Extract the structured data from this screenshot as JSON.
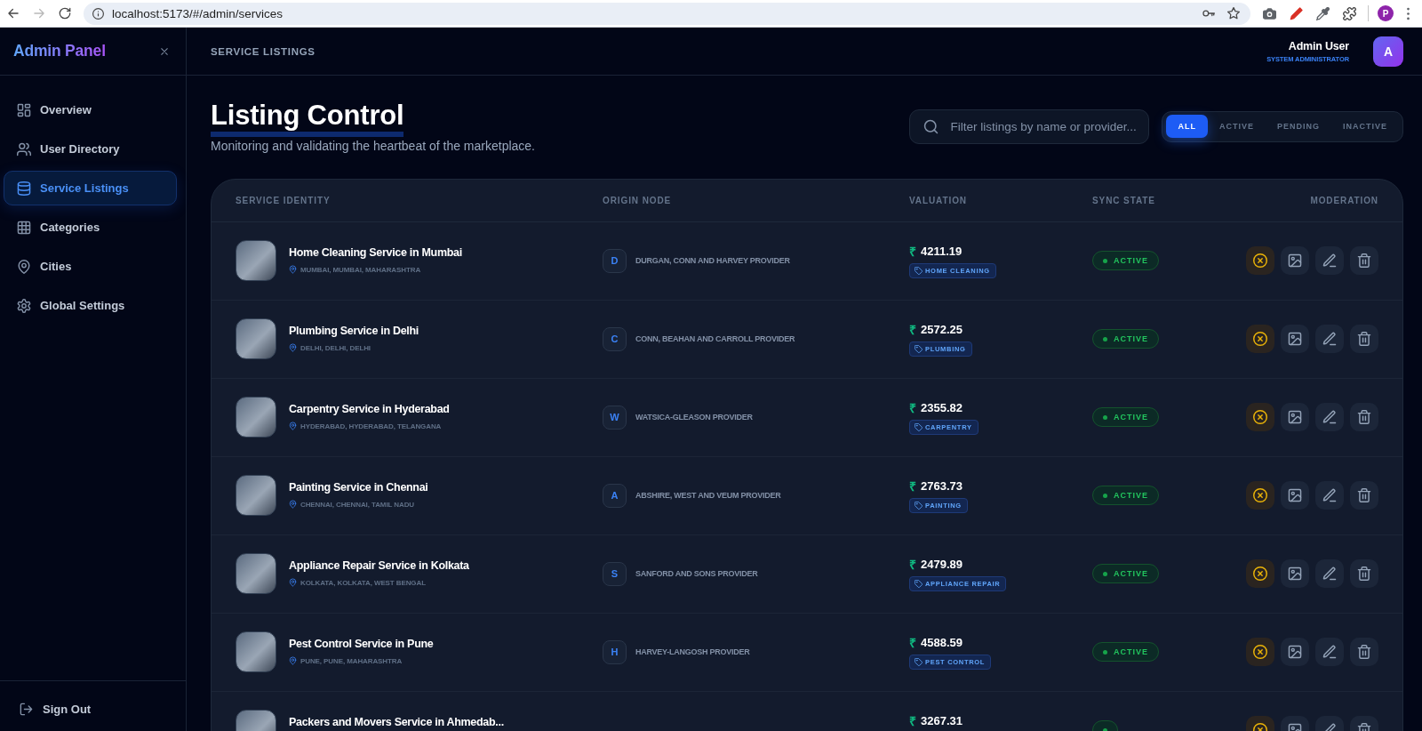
{
  "browser": {
    "nav": [
      {
        "kind": "back",
        "disabled": false
      },
      {
        "kind": "forward",
        "disabled": true
      },
      {
        "kind": "reload",
        "disabled": false
      }
    ],
    "url": "localhost:5173/#/admin/services",
    "profile_initial": "P"
  },
  "sidebar": {
    "brand": "Admin Panel",
    "items": [
      {
        "kind": "overview",
        "label": "Overview",
        "selected": false
      },
      {
        "kind": "users",
        "label": "User Directory",
        "selected": false
      },
      {
        "kind": "listings",
        "label": "Service Listings",
        "selected": true
      },
      {
        "kind": "categories",
        "label": "Categories",
        "selected": false
      },
      {
        "kind": "cities",
        "label": "Cities",
        "selected": false
      },
      {
        "kind": "settings",
        "label": "Global Settings",
        "selected": false
      }
    ],
    "sign_out": "Sign Out"
  },
  "header": {
    "title": "SERVICE LISTINGS",
    "user_name": "Admin User",
    "user_role": "SYSTEM ADMINISTRATOR",
    "avatar_initial": "A"
  },
  "page": {
    "title": "Listing Control",
    "subtitle": "Monitoring and validating the heartbeat of the marketplace."
  },
  "search": {
    "placeholder": "Filter listings by name or provider..."
  },
  "filters": [
    {
      "label": "ALL",
      "selected": true
    },
    {
      "label": "ACTIVE",
      "selected": false
    },
    {
      "label": "PENDING",
      "selected": false
    },
    {
      "label": "INACTIVE",
      "selected": false
    }
  ],
  "table": {
    "columns": [
      "SERVICE IDENTITY",
      "ORIGIN NODE",
      "VALUATION",
      "SYNC STATE",
      "MODERATION"
    ],
    "rows": [
      {
        "title": "Home Cleaning Service in Mumbai",
        "location": "MUMBAI, MUMBAI, MAHARASHTRA",
        "origin_initial": "D",
        "provider": "DURGAN, CONN AND HARVEY PROVIDER",
        "currency": "₹",
        "price": "4211.19",
        "category": "HOME CLEANING",
        "status": {
          "kind": "active",
          "label": "ACTIVE"
        }
      },
      {
        "title": "Plumbing Service in Delhi",
        "location": "DELHI, DELHI, DELHI",
        "origin_initial": "C",
        "provider": "CONN, BEAHAN AND CARROLL PROVIDER",
        "currency": "₹",
        "price": "2572.25",
        "category": "PLUMBING",
        "status": {
          "kind": "active",
          "label": "ACTIVE"
        }
      },
      {
        "title": "Carpentry Service in Hyderabad",
        "location": "HYDERABAD, HYDERABAD, TELANGANA",
        "origin_initial": "W",
        "provider": "WATSICA-GLEASON PROVIDER",
        "currency": "₹",
        "price": "2355.82",
        "category": "CARPENTRY",
        "status": {
          "kind": "active",
          "label": "ACTIVE"
        }
      },
      {
        "title": "Painting Service in Chennai",
        "location": "CHENNAI, CHENNAI, TAMIL NADU",
        "origin_initial": "A",
        "provider": "ABSHIRE, WEST AND VEUM PROVIDER",
        "currency": "₹",
        "price": "2763.73",
        "category": "PAINTING",
        "status": {
          "kind": "active",
          "label": "ACTIVE"
        }
      },
      {
        "title": "Appliance Repair Service in Kolkata",
        "location": "KOLKATA, KOLKATA, WEST BENGAL",
        "origin_initial": "S",
        "provider": "SANFORD AND SONS PROVIDER",
        "currency": "₹",
        "price": "2479.89",
        "category": "APPLIANCE REPAIR",
        "status": {
          "kind": "active",
          "label": "ACTIVE"
        }
      },
      {
        "title": "Pest Control Service in Pune",
        "location": "PUNE, PUNE, MAHARASHTRA",
        "origin_initial": "H",
        "provider": "HARVEY-LANGOSH PROVIDER",
        "currency": "₹",
        "price": "4588.59",
        "category": "PEST CONTROL",
        "status": {
          "kind": "active",
          "label": "ACTIVE"
        }
      },
      {
        "title": "Packers and Movers Service in Ahmedab...",
        "currency": "₹",
        "price": "3267.31",
        "status": {
          "kind": "active"
        }
      }
    ]
  }
}
